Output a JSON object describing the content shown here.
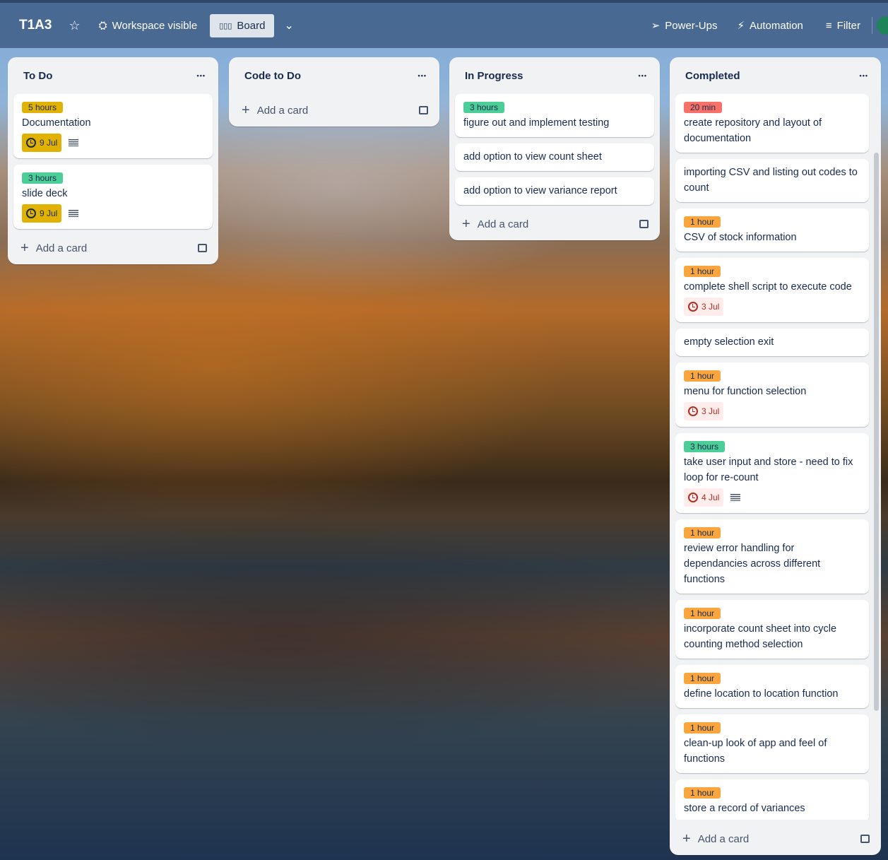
{
  "header": {
    "board_title": "T1A3",
    "visibility": "Workspace visible",
    "view": "Board",
    "power_ups": "Power-Ups",
    "automation": "Automation",
    "filter": "Filter"
  },
  "add_card_label": "Add a card",
  "colors": {
    "yellow": "#e2b203",
    "green": "#4bce97",
    "orange": "#faa53d",
    "red": "#f87168"
  },
  "lists": [
    {
      "title": "To Do",
      "cards": [
        {
          "label": "5 hours",
          "label_color": "yellow",
          "title": "Documentation",
          "date": "9 Jul",
          "date_style": "yellow",
          "description": true
        },
        {
          "label": "3 hours",
          "label_color": "green",
          "title": "slide deck",
          "date": "9 Jul",
          "date_style": "yellow",
          "description": true
        }
      ]
    },
    {
      "title": "Code to Do",
      "cards": []
    },
    {
      "title": "In Progress",
      "cards": [
        {
          "label": "3 hours",
          "label_color": "green",
          "title": "figure out and implement testing"
        },
        {
          "title": "add option to view count sheet"
        },
        {
          "title": "add option to view variance report"
        }
      ]
    },
    {
      "title": "Completed",
      "cards": [
        {
          "label": "20 min",
          "label_color": "red",
          "title": "create repository and layout of documentation"
        },
        {
          "title": "importing CSV and listing out codes to count"
        },
        {
          "label": "1 hour",
          "label_color": "orange",
          "title": "CSV of stock information"
        },
        {
          "label": "1 hour",
          "label_color": "orange",
          "title": "complete shell script to execute code",
          "date": "3 Jul",
          "date_style": "red"
        },
        {
          "title": "empty selection exit"
        },
        {
          "label": "1 hour",
          "label_color": "orange",
          "title": "menu for function selection",
          "date": "3 Jul",
          "date_style": "red"
        },
        {
          "label": "3 hours",
          "label_color": "green",
          "title": "take user input and store - need to fix loop for re-count",
          "date": "4 Jul",
          "date_style": "red",
          "description": true
        },
        {
          "label": "1 hour",
          "label_color": "orange",
          "title": "review error handling for dependancies across different functions"
        },
        {
          "label": "1 hour",
          "label_color": "orange",
          "title": "incorporate count sheet into cycle counting method selection"
        },
        {
          "label": "1 hour",
          "label_color": "orange",
          "title": "define location to location function"
        },
        {
          "label": "1 hour",
          "label_color": "orange",
          "title": "clean-up look of app and feel of functions"
        },
        {
          "label": "1 hour",
          "label_color": "orange",
          "title": "store a record of variances"
        }
      ]
    }
  ]
}
